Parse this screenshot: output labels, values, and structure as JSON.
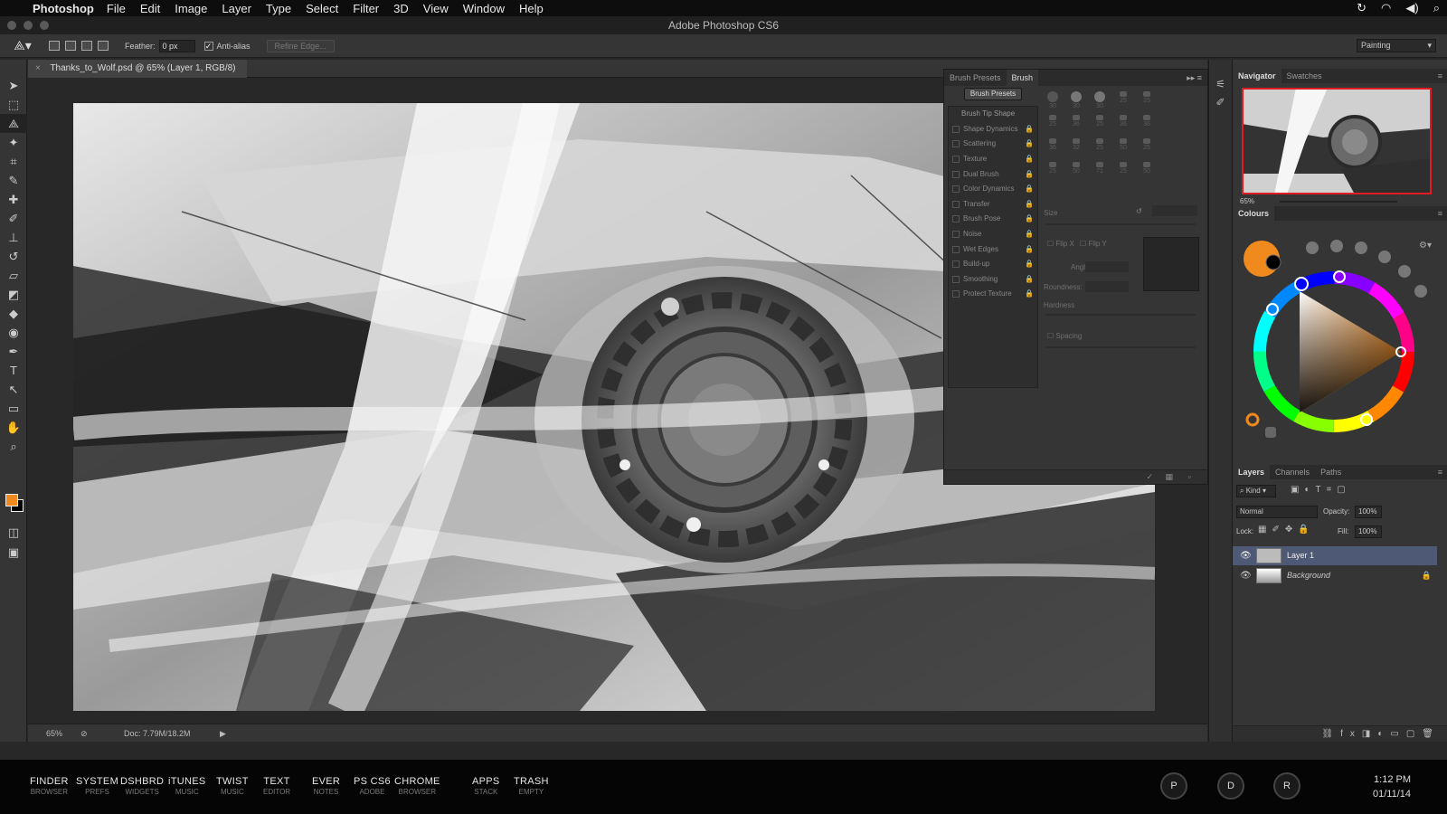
{
  "menubar": {
    "app_name": "Photoshop",
    "menus": [
      "File",
      "Edit",
      "Image",
      "Layer",
      "Type",
      "Select",
      "Filter",
      "3D",
      "View",
      "Window",
      "Help"
    ]
  },
  "window": {
    "title": "Adobe Photoshop CS6"
  },
  "options_bar": {
    "feather_label": "Feather:",
    "feather_value": "0 px",
    "anti_alias_label": "Anti-alias",
    "refine_edge_label": "Refine Edge...",
    "workspace_label": "Painting"
  },
  "document": {
    "tab_title": "Thanks_to_Wolf.psd @ 65% (Layer 1, RGB/8)",
    "zoom": "65%",
    "doc_size": "Doc: 7.79M/18.2M"
  },
  "brush_panel": {
    "tabs": [
      "Brush Presets",
      "Brush"
    ],
    "active_tab": "Brush",
    "presets_button": "Brush Presets",
    "tip_shape_header": "Brush Tip Shape",
    "options": [
      "Shape Dynamics",
      "Scattering",
      "Texture",
      "Dual Brush",
      "Color Dynamics",
      "Transfer",
      "Brush Pose",
      "Noise",
      "Wet Edges",
      "Build-up",
      "Smoothing",
      "Protect Texture"
    ],
    "size_grid": [
      "30",
      "30",
      "30",
      "25",
      "25",
      "25",
      "36",
      "25",
      "36",
      "36",
      "36",
      "32",
      "25",
      "50",
      "25",
      "25",
      "50",
      "71",
      "25",
      "50"
    ],
    "size_label": "Size",
    "flip_x": "Flip X",
    "flip_y": "Flip Y",
    "angle_label": "Angle:",
    "roundness_label": "Roundness:",
    "hardness_label": "Hardness",
    "spacing_label": "Spacing"
  },
  "navigator": {
    "tabs": [
      "Navigator",
      "Swatches"
    ],
    "zoom": "65%"
  },
  "colours": {
    "title": "Colours",
    "foreground": "#f08a1e",
    "background": "#000000"
  },
  "layers": {
    "tabs": [
      "Layers",
      "Channels",
      "Paths"
    ],
    "kind_label": "Kind",
    "blend_mode": "Normal",
    "opacity_label": "Opacity:",
    "opacity_value": "100%",
    "lock_label": "Lock:",
    "fill_label": "Fill:",
    "fill_value": "100%",
    "items": [
      {
        "name": "Layer 1",
        "selected": true
      },
      {
        "name": "Background",
        "locked": true
      }
    ]
  },
  "dock": {
    "items": [
      {
        "title": "FINDER",
        "sub": "BROWSER"
      },
      {
        "title": "SYSTEM",
        "sub": "PREFS"
      },
      {
        "title": "DSHBRD",
        "sub": "WIDGETS"
      },
      {
        "title": "iTUNES",
        "sub": "MUSIC"
      },
      {
        "title": "TWIST",
        "sub": "MUSIC"
      },
      {
        "title": "TEXT",
        "sub": "EDITOR"
      },
      {
        "title": "EVER",
        "sub": "NOTES"
      },
      {
        "title": "PS CS6",
        "sub": "ADOBE"
      },
      {
        "title": "CHROME",
        "sub": "BROWSER"
      },
      {
        "title": "APPS",
        "sub": "STACK"
      },
      {
        "title": "TRASH",
        "sub": "EMPTY"
      }
    ],
    "circles": [
      "P",
      "D",
      "R"
    ],
    "time": "1:12 PM",
    "date": "01/11/14"
  }
}
